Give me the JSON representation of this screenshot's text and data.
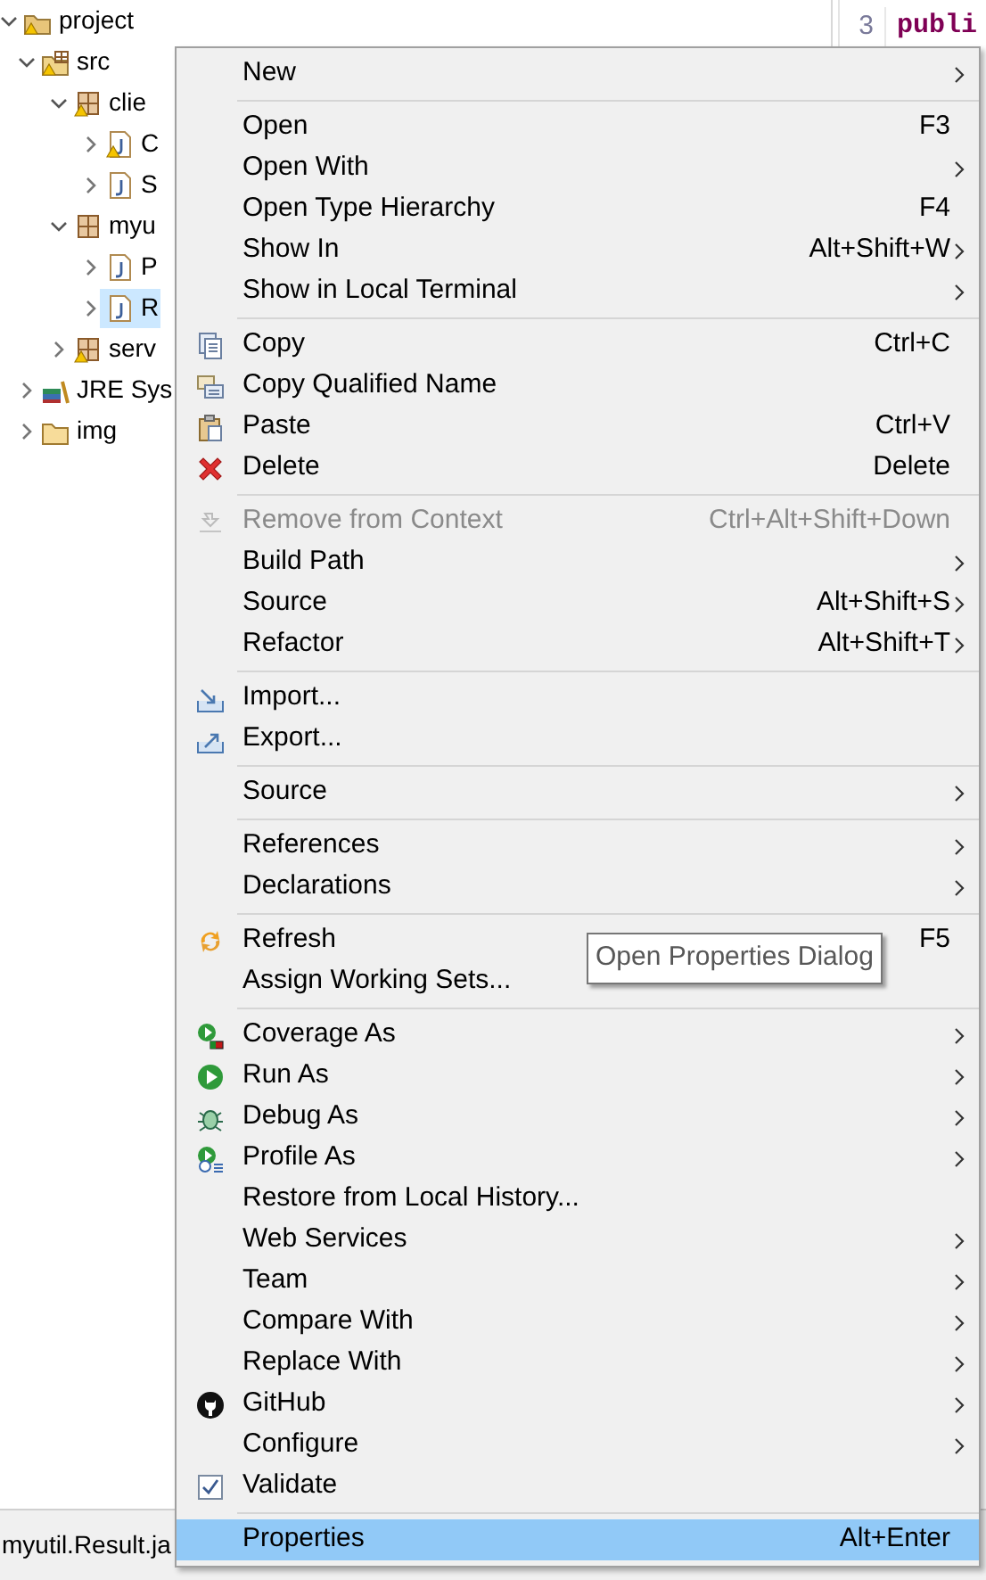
{
  "tree": [
    {
      "label": "project",
      "kind": "project",
      "expanded": true,
      "selected": false,
      "warning": true,
      "children": [
        {
          "label": "src",
          "kind": "source-folder",
          "expanded": true,
          "selected": false,
          "warning": true,
          "children": [
            {
              "label": "clie",
              "kind": "package",
              "expanded": true,
              "selected": false,
              "warning": true,
              "children": [
                {
                  "label": "C",
                  "kind": "java",
                  "expanded": false,
                  "selected": false,
                  "warning": true
                },
                {
                  "label": "S",
                  "kind": "java",
                  "expanded": false,
                  "selected": false,
                  "warning": false
                }
              ]
            },
            {
              "label": "myu",
              "kind": "package",
              "expanded": true,
              "selected": false,
              "warning": false,
              "children": [
                {
                  "label": "P",
                  "kind": "java",
                  "expanded": false,
                  "selected": false,
                  "warning": false
                },
                {
                  "label": "R",
                  "kind": "java",
                  "expanded": false,
                  "selected": true,
                  "warning": false
                }
              ]
            },
            {
              "label": "serv",
              "kind": "package",
              "expanded": false,
              "selected": false,
              "warning": true
            }
          ]
        },
        {
          "label": "JRE Sys",
          "kind": "library",
          "expanded": false,
          "selected": false,
          "warning": false
        },
        {
          "label": "img",
          "kind": "folder",
          "expanded": false,
          "selected": false,
          "warning": false
        }
      ]
    }
  ],
  "editor": {
    "line_number": "3",
    "code": "publi"
  },
  "status_bar": {
    "text": "myutil.Result.ja"
  },
  "context_menu": {
    "items": [
      {
        "kind": "plain",
        "label": "New",
        "submenu": true,
        "disabled": false,
        "selected": false
      },
      {
        "kind": "separator"
      },
      {
        "kind": "plain",
        "label": "Open",
        "shortcut": "F3",
        "submenu": false,
        "disabled": false,
        "selected": false
      },
      {
        "kind": "plain",
        "label": "Open With",
        "submenu": true,
        "disabled": false,
        "selected": false
      },
      {
        "kind": "plain",
        "label": "Open Type Hierarchy",
        "shortcut": "F4",
        "submenu": false,
        "disabled": false,
        "selected": false
      },
      {
        "kind": "plain",
        "label": "Show In",
        "shortcut": "Alt+Shift+W",
        "submenu": true,
        "disabled": false,
        "selected": false
      },
      {
        "kind": "plain",
        "label": "Show in Local Terminal",
        "submenu": true,
        "disabled": false,
        "selected": false
      },
      {
        "kind": "separator"
      },
      {
        "kind": "copy",
        "label": "Copy",
        "shortcut": "Ctrl+C",
        "submenu": false,
        "disabled": false,
        "selected": false
      },
      {
        "kind": "copy-qualified",
        "label": "Copy Qualified Name",
        "submenu": false,
        "disabled": false,
        "selected": false
      },
      {
        "kind": "paste",
        "label": "Paste",
        "shortcut": "Ctrl+V",
        "submenu": false,
        "disabled": false,
        "selected": false
      },
      {
        "kind": "delete",
        "label": "Delete",
        "shortcut": "Delete",
        "submenu": false,
        "disabled": false,
        "selected": false
      },
      {
        "kind": "separator"
      },
      {
        "kind": "remove",
        "label": "Remove from Context",
        "shortcut": "Ctrl+Alt+Shift+Down",
        "submenu": false,
        "disabled": true,
        "selected": false
      },
      {
        "kind": "plain",
        "label": "Build Path",
        "submenu": true,
        "disabled": false,
        "selected": false
      },
      {
        "kind": "plain",
        "label": "Source",
        "shortcut": "Alt+Shift+S",
        "submenu": true,
        "disabled": false,
        "selected": false
      },
      {
        "kind": "plain",
        "label": "Refactor",
        "shortcut": "Alt+Shift+T",
        "submenu": true,
        "disabled": false,
        "selected": false
      },
      {
        "kind": "separator"
      },
      {
        "kind": "import",
        "label": "Import...",
        "submenu": false,
        "disabled": false,
        "selected": false
      },
      {
        "kind": "export",
        "label": "Export...",
        "submenu": false,
        "disabled": false,
        "selected": false
      },
      {
        "kind": "separator"
      },
      {
        "kind": "plain",
        "label": "Source",
        "submenu": true,
        "disabled": false,
        "selected": false
      },
      {
        "kind": "separator"
      },
      {
        "kind": "plain",
        "label": "References",
        "submenu": true,
        "disabled": false,
        "selected": false
      },
      {
        "kind": "plain",
        "label": "Declarations",
        "submenu": true,
        "disabled": false,
        "selected": false
      },
      {
        "kind": "separator"
      },
      {
        "kind": "refresh",
        "label": "Refresh",
        "shortcut": "F5",
        "submenu": false,
        "disabled": false,
        "selected": false
      },
      {
        "kind": "plain",
        "label": "Assign Working Sets...",
        "submenu": false,
        "disabled": false,
        "selected": false
      },
      {
        "kind": "separator"
      },
      {
        "kind": "coverage",
        "label": "Coverage As",
        "submenu": true,
        "disabled": false,
        "selected": false
      },
      {
        "kind": "run",
        "label": "Run As",
        "submenu": true,
        "disabled": false,
        "selected": false
      },
      {
        "kind": "debug",
        "label": "Debug As",
        "submenu": true,
        "disabled": false,
        "selected": false
      },
      {
        "kind": "profile",
        "label": "Profile As",
        "submenu": true,
        "disabled": false,
        "selected": false
      },
      {
        "kind": "plain",
        "label": "Restore from Local History...",
        "submenu": false,
        "disabled": false,
        "selected": false
      },
      {
        "kind": "plain",
        "label": "Web Services",
        "submenu": true,
        "disabled": false,
        "selected": false
      },
      {
        "kind": "plain",
        "label": "Team",
        "submenu": true,
        "disabled": false,
        "selected": false
      },
      {
        "kind": "plain",
        "label": "Compare With",
        "submenu": true,
        "disabled": false,
        "selected": false
      },
      {
        "kind": "plain",
        "label": "Replace With",
        "submenu": true,
        "disabled": false,
        "selected": false
      },
      {
        "kind": "github",
        "label": "GitHub",
        "submenu": true,
        "disabled": false,
        "selected": false
      },
      {
        "kind": "plain",
        "label": "Configure",
        "submenu": true,
        "disabled": false,
        "selected": false
      },
      {
        "kind": "validate",
        "label": "Validate",
        "submenu": false,
        "disabled": false,
        "selected": false
      },
      {
        "kind": "separator"
      },
      {
        "kind": "plain",
        "label": "Properties",
        "shortcut": "Alt+Enter",
        "submenu": false,
        "disabled": false,
        "selected": true
      }
    ]
  },
  "tooltip": {
    "text": "Open Properties Dialog"
  }
}
